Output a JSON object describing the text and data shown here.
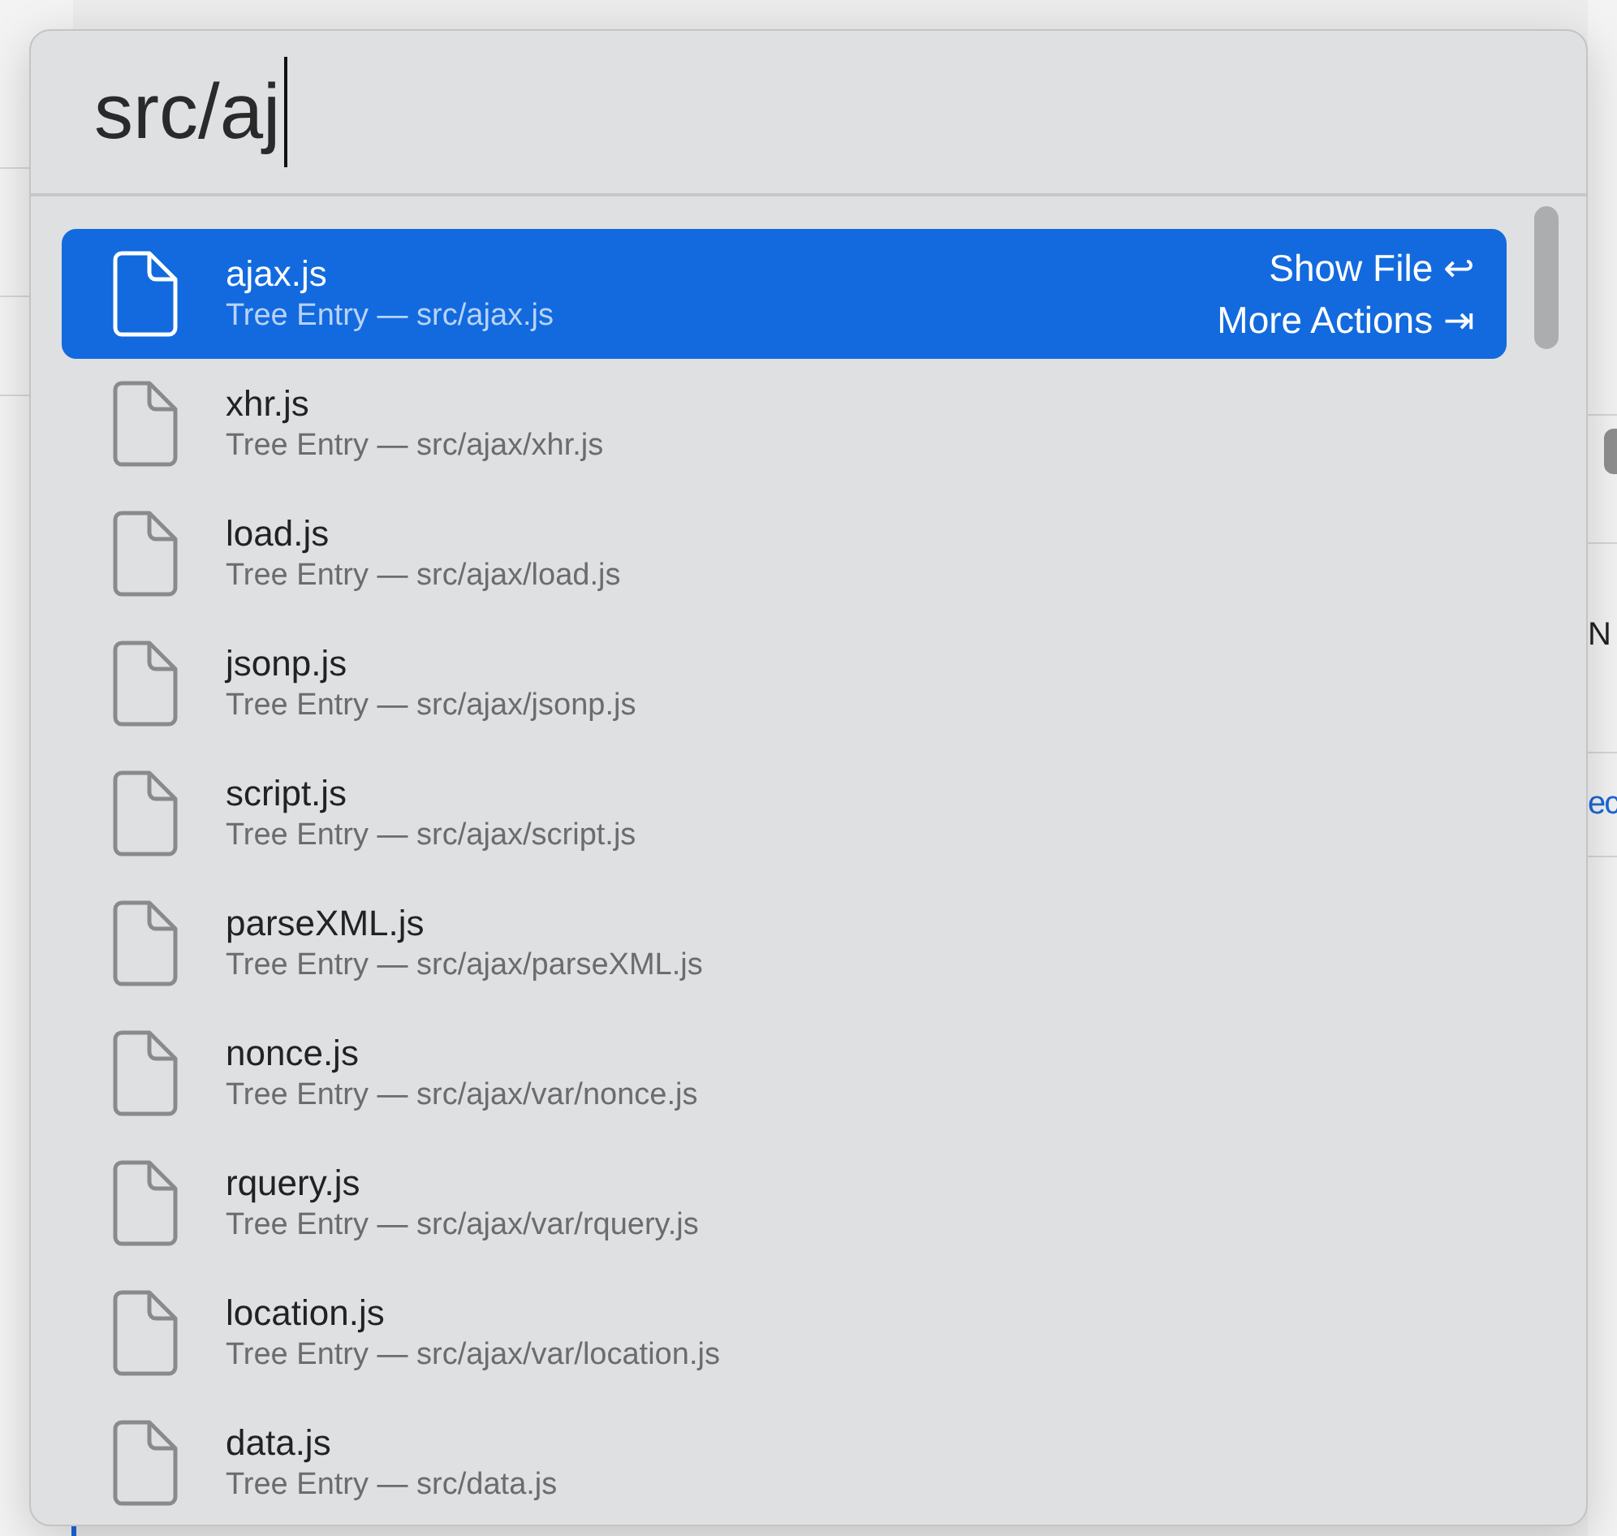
{
  "search": {
    "value": "src/aj"
  },
  "results": [
    {
      "name": "ajax.js",
      "detail": "Tree Entry — src/ajax.js",
      "selected": true,
      "actions": [
        {
          "label": "Show File",
          "key": "↩"
        },
        {
          "label": "More Actions",
          "key": "⇥"
        }
      ]
    },
    {
      "name": "xhr.js",
      "detail": "Tree Entry — src/ajax/xhr.js",
      "selected": false
    },
    {
      "name": "load.js",
      "detail": "Tree Entry — src/ajax/load.js",
      "selected": false
    },
    {
      "name": "jsonp.js",
      "detail": "Tree Entry — src/ajax/jsonp.js",
      "selected": false
    },
    {
      "name": "script.js",
      "detail": "Tree Entry — src/ajax/script.js",
      "selected": false
    },
    {
      "name": "parseXML.js",
      "detail": "Tree Entry — src/ajax/parseXML.js",
      "selected": false
    },
    {
      "name": "nonce.js",
      "detail": "Tree Entry — src/ajax/var/nonce.js",
      "selected": false
    },
    {
      "name": "rquery.js",
      "detail": "Tree Entry — src/ajax/var/rquery.js",
      "selected": false
    },
    {
      "name": "location.js",
      "detail": "Tree Entry — src/ajax/var/location.js",
      "selected": false
    },
    {
      "name": "data.js",
      "detail": "Tree Entry — src/data.js",
      "selected": false
    }
  ],
  "background": {
    "heading_fragment": "N",
    "link_fragment": "ec"
  }
}
